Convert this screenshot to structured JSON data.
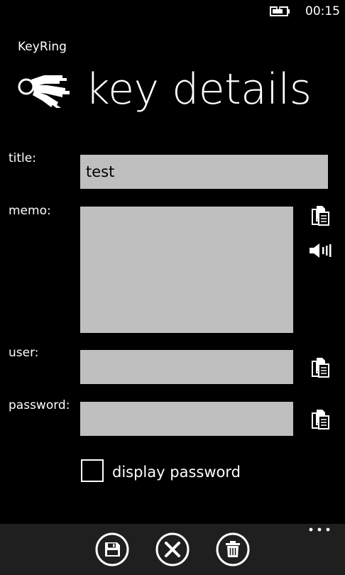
{
  "status_bar": {
    "time": "00:15"
  },
  "header": {
    "app_name": "KeyRing",
    "page_title": "key details"
  },
  "form": {
    "title": {
      "label": "title:",
      "value": "test"
    },
    "memo": {
      "label": "memo:",
      "value": ""
    },
    "user": {
      "label": "user:",
      "value": ""
    },
    "password": {
      "label": "password:",
      "value": ""
    },
    "display_password": {
      "label": "display password",
      "checked": false
    }
  },
  "app_bar": {
    "buttons": [
      "save",
      "cancel",
      "delete"
    ]
  },
  "colors": {
    "background": "#000000",
    "field": "#bfbfbf",
    "app_bar": "#1f1f1f",
    "foreground": "#ffffff"
  },
  "icons": [
    "battery-charging-icon",
    "keys-icon",
    "copy-icon",
    "speaker-icon",
    "save-icon",
    "cancel-icon",
    "delete-icon",
    "more-icon"
  ]
}
